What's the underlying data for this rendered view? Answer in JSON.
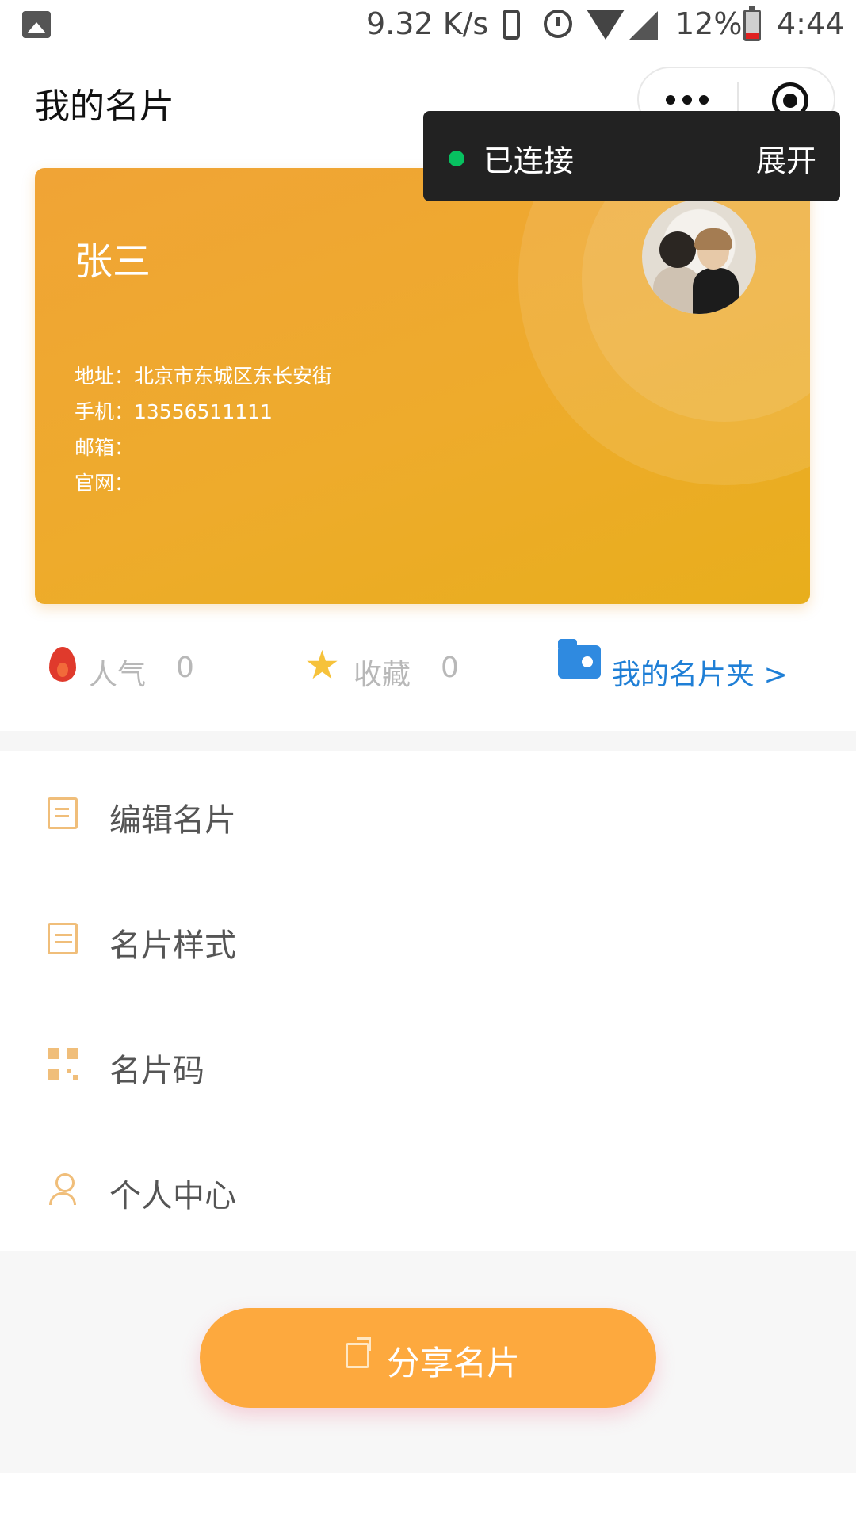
{
  "status_bar": {
    "net_speed": "9.32 K/s",
    "battery": "12%",
    "time": "4:44"
  },
  "header": {
    "title": "我的名片"
  },
  "toast": {
    "text": "已连接",
    "expand": "展开",
    "dot_color": "#07c160"
  },
  "card": {
    "name": "张三",
    "address": "地址：北京市东城区东长安街",
    "phone": "手机：13556511111",
    "email": "邮箱：",
    "website": "官网："
  },
  "stats": {
    "popularity_label": "人气",
    "popularity_value": "0",
    "favorites_label": "收藏",
    "favorites_value": "0",
    "folder_link": "我的名片夹 >"
  },
  "menu": {
    "items": [
      {
        "label": "编辑名片",
        "icon": "edit-icon"
      },
      {
        "label": "名片样式",
        "icon": "card-style-icon"
      },
      {
        "label": "名片码",
        "icon": "qr-code-icon"
      },
      {
        "label": "个人中心",
        "icon": "user-icon"
      }
    ]
  },
  "share": {
    "label": "分享名片"
  },
  "colors": {
    "card_orange": "#f0a436",
    "share_button": "#fda93e",
    "link_blue": "#1f7fd6",
    "icon_orange": "#f0be7a"
  }
}
